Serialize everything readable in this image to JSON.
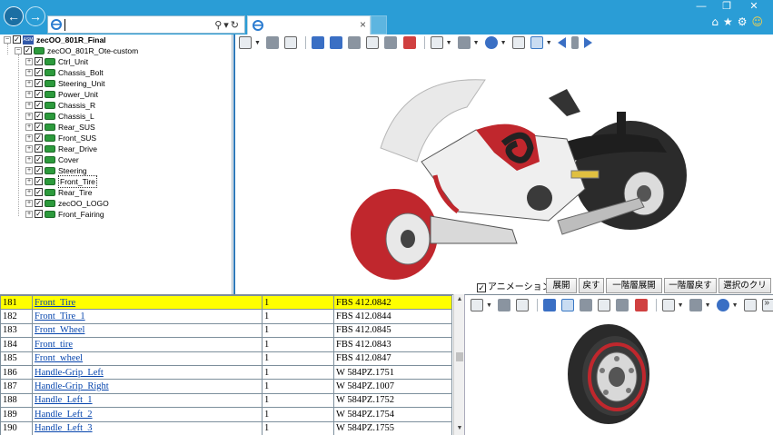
{
  "browser": {
    "address_value": "",
    "tab_title": "",
    "window_controls": [
      "minimize-icon",
      "restore-icon",
      "close-icon"
    ],
    "right_icons": [
      "home-icon",
      "favorites-star-icon",
      "settings-gear-icon",
      "smiley-feedback-icon"
    ]
  },
  "tree": {
    "root": "zecOO_801R_Final",
    "sub": "zecOO_801R_Ote-custom",
    "items": [
      "Ctrl_Unit",
      "Chassis_Bolt",
      "Steering_Unit",
      "Power_Unit",
      "Chassis_R",
      "Chassis_L",
      "Rear_SUS",
      "Front_SUS",
      "Rear_Drive",
      "Cover",
      "Steering",
      "Front_Tire",
      "Rear_Tire",
      "zecOO_LOGO",
      "Front_Fairing"
    ],
    "selected": "Front_Tire"
  },
  "controls": {
    "animation_label": "アニメーション",
    "animation_checked": true,
    "buttons": [
      "展開",
      "戻す",
      "一階層展開",
      "一階層戻す",
      "選択のクリア"
    ]
  },
  "parts_table": {
    "rows": [
      {
        "no": "181",
        "name": "Front_Tire",
        "qty": "1",
        "code": "FBS 412.0842",
        "highlight": true
      },
      {
        "no": "182",
        "name": "Front_Tire_1",
        "qty": "1",
        "code": "FBS 412.0844"
      },
      {
        "no": "183",
        "name": "Front_Wheel",
        "qty": "1",
        "code": "FBS 412.0845"
      },
      {
        "no": "184",
        "name": "Front_tire",
        "qty": "1",
        "code": "FBS 412.0843"
      },
      {
        "no": "185",
        "name": "Front_wheel",
        "qty": "1",
        "code": "FBS 412.0847"
      },
      {
        "no": "186",
        "name": "Handle-Grip_Left",
        "qty": "1",
        "code": "W 584PZ.1751"
      },
      {
        "no": "187",
        "name": "Handle-Grip_Right",
        "qty": "1",
        "code": "W 584PZ.1007"
      },
      {
        "no": "188",
        "name": "Handle_Left_1",
        "qty": "1",
        "code": "W 584PZ.1752"
      },
      {
        "no": "189",
        "name": "Handle_Left_2",
        "qty": "1",
        "code": "W 584PZ.1754"
      },
      {
        "no": "190",
        "name": "Handle_Left_3",
        "qty": "1",
        "code": "W 584PZ.1755"
      }
    ]
  },
  "colors": {
    "chrome": "#2a9dd6",
    "highlight_row": "#ffff00",
    "link": "#0645ad",
    "model_red": "#c0272d"
  }
}
